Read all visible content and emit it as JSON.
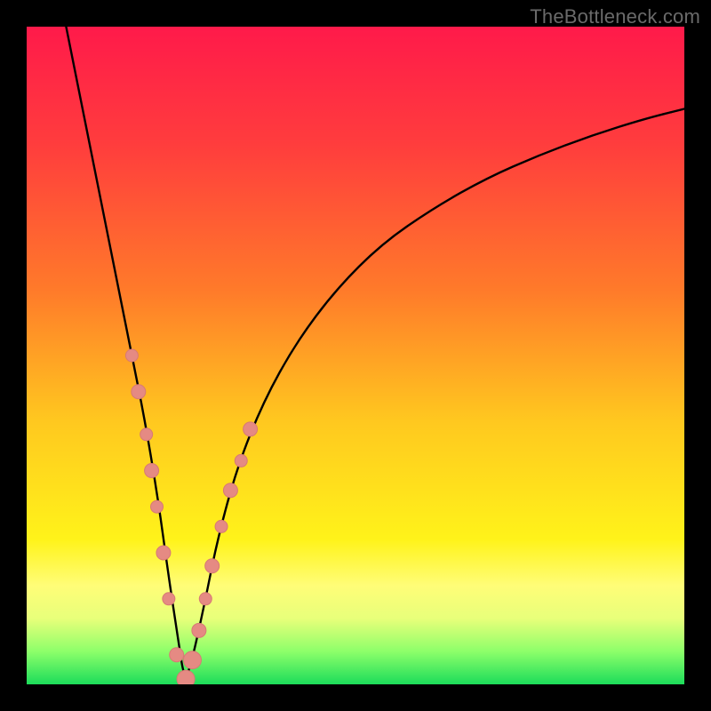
{
  "watermark": "TheBottleneck.com",
  "colors": {
    "frame": "#000000",
    "gradient_stops": [
      {
        "offset": 0.0,
        "color": "#ff1a4a"
      },
      {
        "offset": 0.18,
        "color": "#ff3d3d"
      },
      {
        "offset": 0.4,
        "color": "#ff7a2a"
      },
      {
        "offset": 0.6,
        "color": "#ffc81f"
      },
      {
        "offset": 0.78,
        "color": "#fff31a"
      },
      {
        "offset": 0.85,
        "color": "#fffd78"
      },
      {
        "offset": 0.9,
        "color": "#e8ff7a"
      },
      {
        "offset": 0.95,
        "color": "#8dff6a"
      },
      {
        "offset": 1.0,
        "color": "#1cdc5a"
      }
    ],
    "line": "#000000",
    "marker_fill": "#e58a83",
    "marker_stroke": "#d77a74"
  },
  "chart_data": {
    "type": "line",
    "title": "",
    "xlabel": "",
    "ylabel": "",
    "xlim": [
      0,
      100
    ],
    "ylim": [
      0,
      100
    ],
    "note": "Axes are unlabeled; values are relative percentages of the plot area (0–100). y=100 is top, y=0 is bottom. The curve is a V-shaped bottleneck curve with its minimum near x≈24, y≈0.",
    "series": [
      {
        "name": "bottleneck-curve",
        "x": [
          6,
          8,
          10,
          12,
          14,
          16,
          18,
          20,
          21.5,
          23,
          24,
          25,
          27,
          29,
          32,
          36,
          41,
          47,
          54,
          62,
          70,
          78,
          86,
          94,
          100
        ],
        "y": [
          100,
          90,
          80,
          70,
          60,
          50,
          40,
          28,
          17,
          7,
          0.5,
          3,
          12,
          22,
          33,
          43,
          52,
          60,
          67,
          72.5,
          77,
          80.5,
          83.5,
          86,
          87.5
        ]
      }
    ],
    "markers": {
      "name": "highlight-dots",
      "x": [
        16.0,
        17.0,
        18.2,
        19.0,
        19.8,
        20.8,
        21.6,
        22.8,
        24.2,
        25.2,
        26.2,
        27.2,
        28.2,
        29.6,
        31.0,
        32.6,
        34.0
      ],
      "y": [
        50.0,
        44.5,
        38.0,
        32.5,
        27.0,
        20.0,
        13.0,
        4.5,
        0.8,
        3.7,
        8.2,
        13.0,
        18.0,
        24.0,
        29.5,
        34.0,
        38.8
      ],
      "r": [
        7,
        8,
        7,
        8,
        7,
        8,
        7,
        8,
        10,
        10,
        8,
        7,
        8,
        7,
        8,
        7,
        8
      ]
    }
  }
}
